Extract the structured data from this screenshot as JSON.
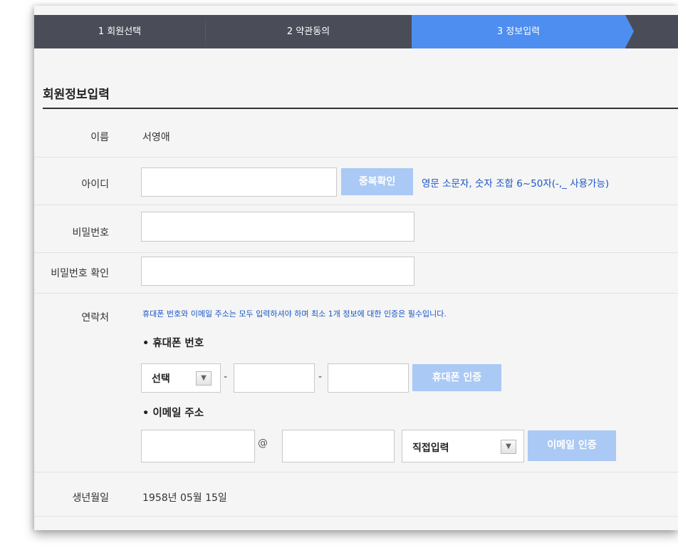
{
  "steps": [
    {
      "label": "1 회원선택"
    },
    {
      "label": "2 약관동의"
    },
    {
      "label": "3 정보입력"
    }
  ],
  "section_title": "회원정보입력",
  "form": {
    "name": {
      "label": "이름",
      "value": "서영애"
    },
    "id": {
      "label": "아이디",
      "value": "",
      "check_button": "중복확인",
      "hint": "영문 소문자, 숫자 조합 6~50자(-,_ 사용가능)"
    },
    "password": {
      "label": "비밀번호",
      "value": ""
    },
    "password_confirm": {
      "label": "비밀번호 확인",
      "value": ""
    },
    "contact": {
      "label": "연락처",
      "notice": "휴대폰 번호와 이메일 주소는 모두 입력하셔야 하며 최소 1개 정보에 대한 인증은 필수입니다.",
      "phone": {
        "title": "• 휴대폰 번호",
        "carrier_select": "선택",
        "separator": "-",
        "middle": "",
        "last": "",
        "verify_button": "휴대폰 인증"
      },
      "email": {
        "title": "• 이메일 주소",
        "local": "",
        "at": "@",
        "domain": "",
        "domain_select": "직접입력",
        "verify_button": "이메일 인증"
      }
    },
    "birth": {
      "label": "생년월일",
      "value": "1958년 05월 15일"
    }
  },
  "icons": {
    "dropdown": "triangle-down-icon"
  },
  "colors": {
    "active_step": "#4d8ef0",
    "step_bar": "#4a4d58",
    "disabled_button": "#aac9f4",
    "hint_text": "#1a56c8"
  }
}
